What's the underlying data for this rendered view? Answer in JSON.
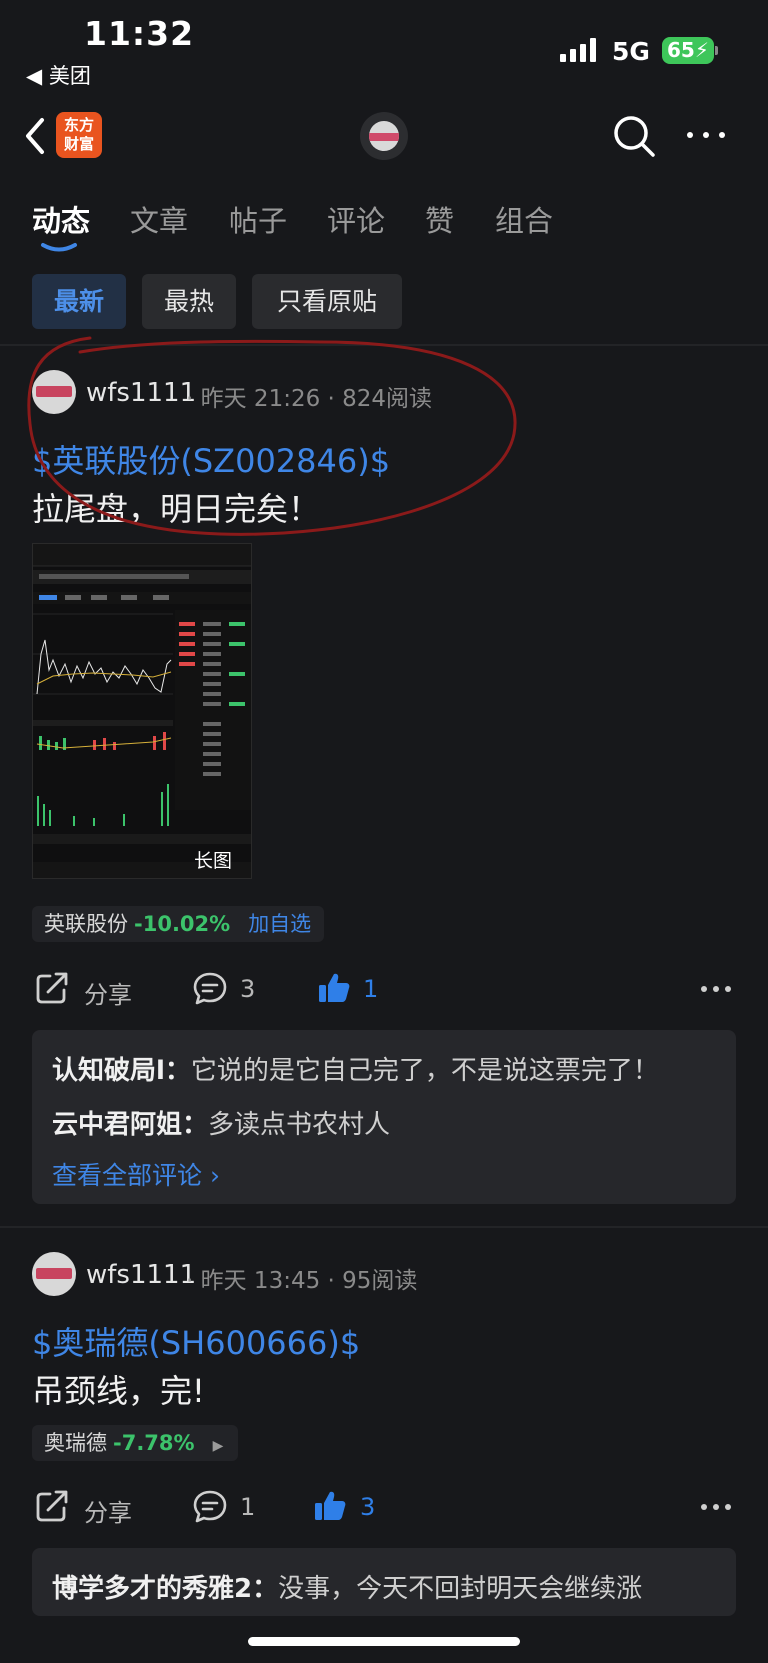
{
  "status_bar": {
    "time": "11:32",
    "back_app": "◀ 美团",
    "network": "5G",
    "battery": "65"
  },
  "nav": {
    "logo_line1": "东方",
    "logo_line2": "财富"
  },
  "tabs": [
    {
      "label": "动态",
      "active": true
    },
    {
      "label": "文章"
    },
    {
      "label": "帖子"
    },
    {
      "label": "评论"
    },
    {
      "label": "赞"
    },
    {
      "label": "组合"
    }
  ],
  "filters": [
    {
      "label": "最新",
      "active": true
    },
    {
      "label": "最热"
    },
    {
      "label": "只看原贴"
    }
  ],
  "posts": [
    {
      "author": "wfs1111",
      "time": "昨天 21:26",
      "reads": "824阅读",
      "stock_link": "$英联股份(SZ002846)$",
      "text": "拉尾盘，明日完矣！",
      "image_label": "长图",
      "stock_chip": {
        "name": "英联股份",
        "change": "-10.02%",
        "action": "加自选"
      },
      "actions": {
        "share": "分享",
        "comments": "3",
        "likes": "1"
      },
      "comments": [
        {
          "user": "认知破局l：",
          "text": "它说的是它自己完了，不是说这票完了！"
        },
        {
          "user": "云中君阿姐：",
          "text": "多读点书农村人"
        }
      ],
      "view_all": "查看全部评论 ›"
    },
    {
      "author": "wfs1111",
      "time": "昨天 13:45",
      "reads": "95阅读",
      "stock_link": "$奥瑞德(SH600666)$",
      "text": "吊颈线，完!",
      "stock_chip": {
        "name": "奥瑞德",
        "change": "-7.78%",
        "arrow": "▶"
      },
      "actions": {
        "share": "分享",
        "comments": "1",
        "likes": "3"
      },
      "comments": [
        {
          "user": "博学多才的秀雅2：",
          "text": "没事，今天不回封明天会继续涨"
        }
      ]
    }
  ],
  "colors": {
    "link": "#3f86e6",
    "down": "#3cc36b",
    "annotation": "#8b1a1a"
  }
}
